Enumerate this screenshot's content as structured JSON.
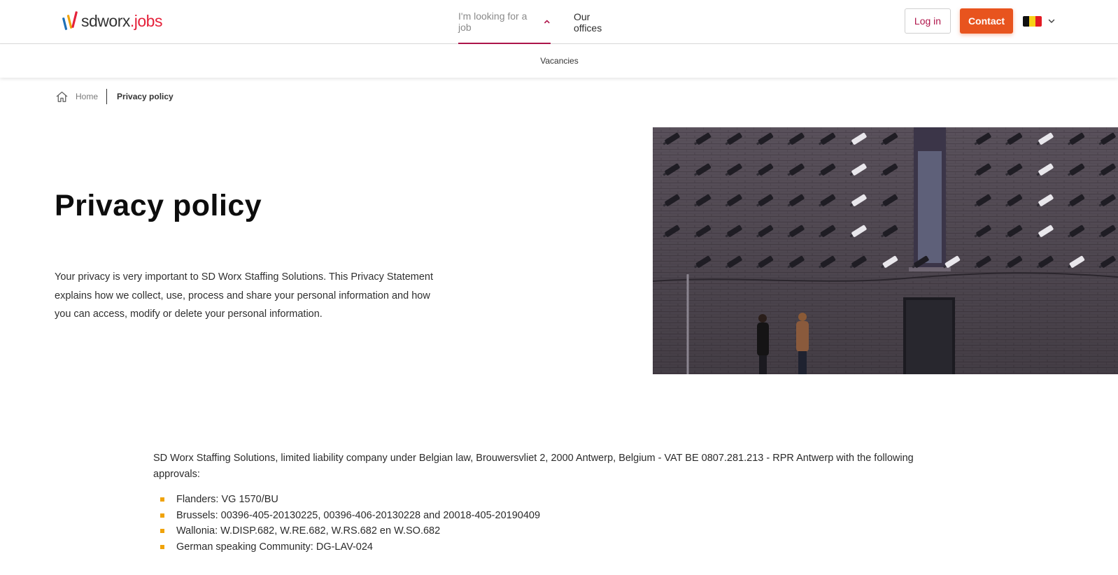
{
  "brand": {
    "sd": "sd",
    "worx": "worx",
    "jobs": ".jobs",
    "colors": {
      "red": "#e5213a",
      "gold": "#f0a30a",
      "blue": "#1d70b8",
      "accent": "#b0164b",
      "contact": "#e8541e"
    }
  },
  "nav": {
    "looking_for_job": "I'm looking for a job",
    "our_offices": "Our offices"
  },
  "header": {
    "login_label": "Log in",
    "contact_label": "Contact",
    "language_flag": "belgium-flag-icon"
  },
  "subnav": {
    "vacancies": "Vacancies"
  },
  "breadcrumb": {
    "home": "Home",
    "current": "Privacy policy"
  },
  "hero": {
    "title": "Privacy policy",
    "intro": "Your privacy is very important to SD Worx Staffing Solutions. This Privacy Statement explains how we collect, use, process and share your personal information and how you can access, modify or delete your personal information."
  },
  "body": {
    "company_info": "SD Worx Staffing Solutions, limited liability company under Belgian law, Brouwersvliet 2, 2000 Antwerp, Belgium - VAT BE 0807.281.213 - RPR Antwerp with the following approvals:",
    "approvals": [
      "Flanders: VG 1570/BU",
      "Brussels: 00396-405-20130225, 00396-406-20130228 and 20018-405-20190409",
      "Wallonia: W.DISP.682, W.RE.682, W.RS.682 en W.SO.682",
      "German speaking Community: DG-LAV-024"
    ]
  }
}
